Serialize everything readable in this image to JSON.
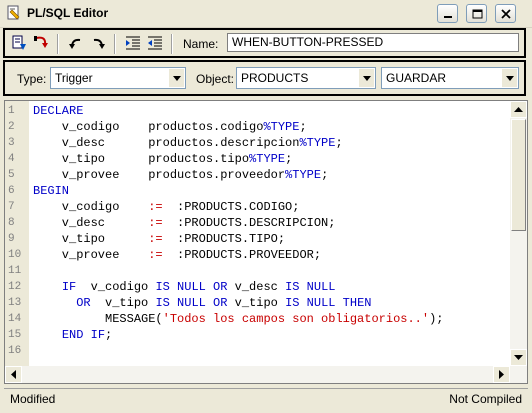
{
  "window": {
    "title": "PL/SQL Editor",
    "controls": [
      "minimize",
      "maximize",
      "close"
    ]
  },
  "toolbar": {
    "icons": [
      "compile-icon",
      "revert-icon",
      "undo-icon",
      "redo-icon",
      "indent-icon",
      "outdent-icon"
    ],
    "name_label": "Name:",
    "name_value": "WHEN-BUTTON-PRESSED"
  },
  "selectors": {
    "type_label": "Type:",
    "type_value": "Trigger",
    "object_label": "Object:",
    "object_value": "PRODUCTS",
    "item_value": "GUARDAR"
  },
  "editor": {
    "lines": [
      {
        "n": "1",
        "tokens": [
          {
            "t": "DECLARE",
            "c": "kw"
          }
        ]
      },
      {
        "n": "2",
        "tokens": [
          {
            "t": "    v_codigo    productos.codigo",
            "c": ""
          },
          {
            "t": "%TYPE",
            "c": "kw"
          },
          {
            "t": ";",
            "c": ""
          }
        ]
      },
      {
        "n": "3",
        "tokens": [
          {
            "t": "    v_desc      productos.descripcion",
            "c": ""
          },
          {
            "t": "%TYPE",
            "c": "kw"
          },
          {
            "t": ";",
            "c": ""
          }
        ]
      },
      {
        "n": "4",
        "tokens": [
          {
            "t": "    v_tipo      productos.tipo",
            "c": ""
          },
          {
            "t": "%TYPE",
            "c": "kw"
          },
          {
            "t": ";",
            "c": ""
          }
        ]
      },
      {
        "n": "5",
        "tokens": [
          {
            "t": "    v_provee    productos.proveedor",
            "c": ""
          },
          {
            "t": "%TYPE",
            "c": "kw"
          },
          {
            "t": ";",
            "c": ""
          }
        ]
      },
      {
        "n": "6",
        "tokens": [
          {
            "t": "BEGIN",
            "c": "kw"
          }
        ]
      },
      {
        "n": "7",
        "tokens": [
          {
            "t": "    v_codigo    ",
            "c": ""
          },
          {
            "t": ":=",
            "c": "op"
          },
          {
            "t": "  :PRODUCTS.CODIGO;",
            "c": ""
          }
        ]
      },
      {
        "n": "8",
        "tokens": [
          {
            "t": "    v_desc      ",
            "c": ""
          },
          {
            "t": ":=",
            "c": "op"
          },
          {
            "t": "  :PRODUCTS.DESCRIPCION;",
            "c": ""
          }
        ]
      },
      {
        "n": "9",
        "tokens": [
          {
            "t": "    v_tipo      ",
            "c": ""
          },
          {
            "t": ":=",
            "c": "op"
          },
          {
            "t": "  :PRODUCTS.TIPO;",
            "c": ""
          }
        ]
      },
      {
        "n": "10",
        "tokens": [
          {
            "t": "    v_provee    ",
            "c": ""
          },
          {
            "t": ":=",
            "c": "op"
          },
          {
            "t": "  :PRODUCTS.PROVEEDOR;",
            "c": ""
          }
        ]
      },
      {
        "n": "11",
        "tokens": [
          {
            "t": "",
            "c": ""
          }
        ]
      },
      {
        "n": "12",
        "tokens": [
          {
            "t": "    ",
            "c": ""
          },
          {
            "t": "IF",
            "c": "kw"
          },
          {
            "t": "  v_codigo ",
            "c": ""
          },
          {
            "t": "IS NULL OR",
            "c": "kw"
          },
          {
            "t": " v_desc ",
            "c": ""
          },
          {
            "t": "IS NULL",
            "c": "kw"
          }
        ]
      },
      {
        "n": "13",
        "tokens": [
          {
            "t": "      ",
            "c": ""
          },
          {
            "t": "OR",
            "c": "kw"
          },
          {
            "t": "  v_tipo ",
            "c": ""
          },
          {
            "t": "IS NULL OR",
            "c": "kw"
          },
          {
            "t": " v_tipo ",
            "c": ""
          },
          {
            "t": "IS NULL THEN",
            "c": "kw"
          }
        ]
      },
      {
        "n": "14",
        "tokens": [
          {
            "t": "          MESSAGE(",
            "c": ""
          },
          {
            "t": "'Todos los campos son obligatorios..'",
            "c": "str"
          },
          {
            "t": ");",
            "c": ""
          }
        ]
      },
      {
        "n": "15",
        "tokens": [
          {
            "t": "    ",
            "c": ""
          },
          {
            "t": "END IF",
            "c": "kw"
          },
          {
            "t": ";",
            "c": ""
          }
        ]
      },
      {
        "n": "16",
        "tokens": [
          {
            "t": "",
            "c": ""
          }
        ]
      }
    ]
  },
  "status": {
    "left": "Modified",
    "right": "Not Compiled"
  }
}
